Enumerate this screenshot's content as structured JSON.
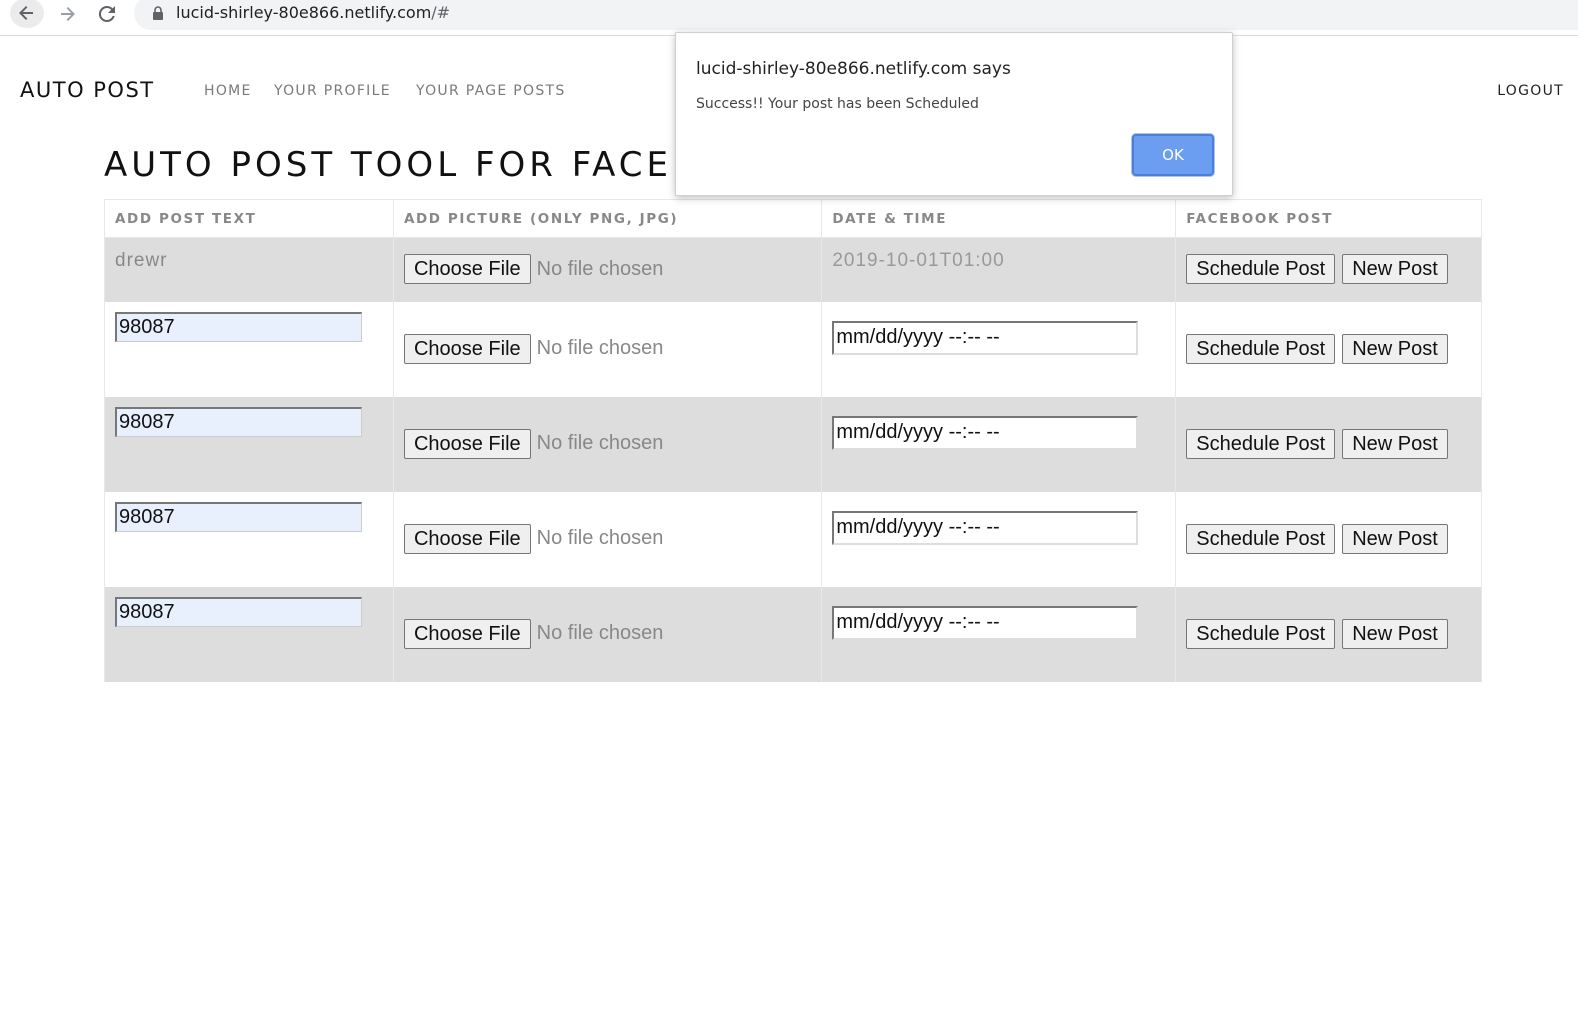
{
  "browser": {
    "url_host": "lucid-shirley-80e866.netlify.com",
    "url_path": "/#",
    "icons": [
      "back-arrow-icon",
      "forward-arrow-icon",
      "reload-icon",
      "lock-icon"
    ]
  },
  "header": {
    "brand": "AUTO POST",
    "nav": [
      "HOME",
      "YOUR PROFILE",
      "YOUR PAGE POSTS"
    ],
    "logout": "LOGOUT"
  },
  "page_title": "AUTO POST TOOL FOR FACEBOOK",
  "table": {
    "headers": [
      "ADD POST TEXT",
      "ADD PICTURE (ONLY PNG, JPG)",
      "DATE & TIME",
      "FACEBOOK POST"
    ],
    "first_row": {
      "text": "drewr",
      "file_button": "Choose File",
      "file_status": "No file chosen",
      "datetime": "2019-10-01T01:00",
      "schedule": "Schedule Post",
      "new_post": "New Post"
    },
    "rows": [
      {
        "text": "98087",
        "file_button": "Choose File",
        "file_status": "No file chosen",
        "date_placeholder": "mm/dd/yyyy --:-- --",
        "schedule": "Schedule Post",
        "new_post": "New Post"
      },
      {
        "text": "98087",
        "file_button": "Choose File",
        "file_status": "No file chosen",
        "date_placeholder": "mm/dd/yyyy --:-- --",
        "schedule": "Schedule Post",
        "new_post": "New Post"
      },
      {
        "text": "98087",
        "file_button": "Choose File",
        "file_status": "No file chosen",
        "date_placeholder": "mm/dd/yyyy --:-- --",
        "schedule": "Schedule Post",
        "new_post": "New Post"
      },
      {
        "text": "98087",
        "file_button": "Choose File",
        "file_status": "No file chosen",
        "date_placeholder": "mm/dd/yyyy --:-- --",
        "schedule": "Schedule Post",
        "new_post": "New Post"
      }
    ]
  },
  "dialog": {
    "title": "lucid-shirley-80e866.netlify.com says",
    "message": "Success!! Your post has been Scheduled",
    "ok": "OK"
  },
  "colors": {
    "row_shade": "#dddddd",
    "input_autofill": "#e8f0fe",
    "ok_button": "#6b9df1"
  }
}
